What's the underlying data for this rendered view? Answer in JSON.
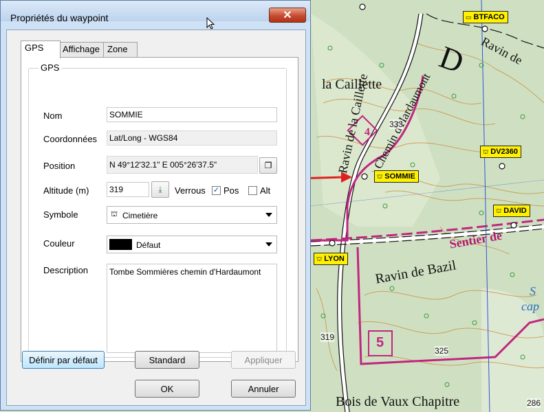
{
  "dialog": {
    "title": "Propriétés du waypoint",
    "close_glyph": "✕",
    "tabs": [
      {
        "label": "GPS",
        "active": true
      },
      {
        "label": "Affichage",
        "active": false
      },
      {
        "label": "Zone",
        "active": false
      }
    ],
    "group_title": "GPS",
    "fields": {
      "nom_label": "Nom",
      "nom_value": "SOMMIE",
      "coord_label": "Coordonnées",
      "coord_value": "Lat/Long - WGS84",
      "position_label": "Position",
      "position_value": "N 49°12'32.1\"  E 005°26'37.5\"",
      "altitude_label": "Altitude (m)",
      "altitude_value": "319",
      "verrous_label": "Verrous",
      "pos_label": "Pos",
      "pos_checked": true,
      "alt_label": "Alt",
      "alt_checked": false,
      "symbole_label": "Symbole",
      "symbole_value": "Cimetière",
      "couleur_label": "Couleur",
      "couleur_value": "Défaut",
      "couleur_swatch": "#000000",
      "description_label": "Description",
      "description_value": "Tombe Sommières chemin d'Hardaumont"
    },
    "buttons": {
      "definir": "Définir par défaut",
      "standard": "Standard",
      "appliquer": "Appliquer",
      "ok": "OK",
      "annuler": "Annuler"
    }
  },
  "map": {
    "waypoints": [
      {
        "name": "BTFACO",
        "icon": "bridge-icon"
      },
      {
        "name": "DV2360",
        "icon": "cemetery-icon"
      },
      {
        "name": "SOMMIE",
        "icon": "cemetery-icon"
      },
      {
        "name": "DAVID",
        "icon": "cemetery-icon"
      },
      {
        "name": "LYON",
        "icon": "cemetery-icon"
      }
    ],
    "labels": {
      "caillette": "la Caillette",
      "ravin_caillette": "Ravin de la Caillette",
      "chemin": "Chemin d'Hardaumont",
      "ravin_bazil": "Ravin de Bazil",
      "sentier": "Sentier de",
      "bois": "Bois de Vaux Chapitre",
      "ravin_de": "Ravin de",
      "letter_d": "D",
      "blue_s": "S",
      "blue_cap": "cap",
      "parcel_4": "4",
      "parcel_5": "5"
    },
    "elevations": [
      "333",
      "319",
      "325",
      "286"
    ],
    "colors": {
      "waypoint_label": "#fff100",
      "boundary": "#c0267f",
      "arrow": "#e02020",
      "forest": "#cfe0c2"
    }
  }
}
